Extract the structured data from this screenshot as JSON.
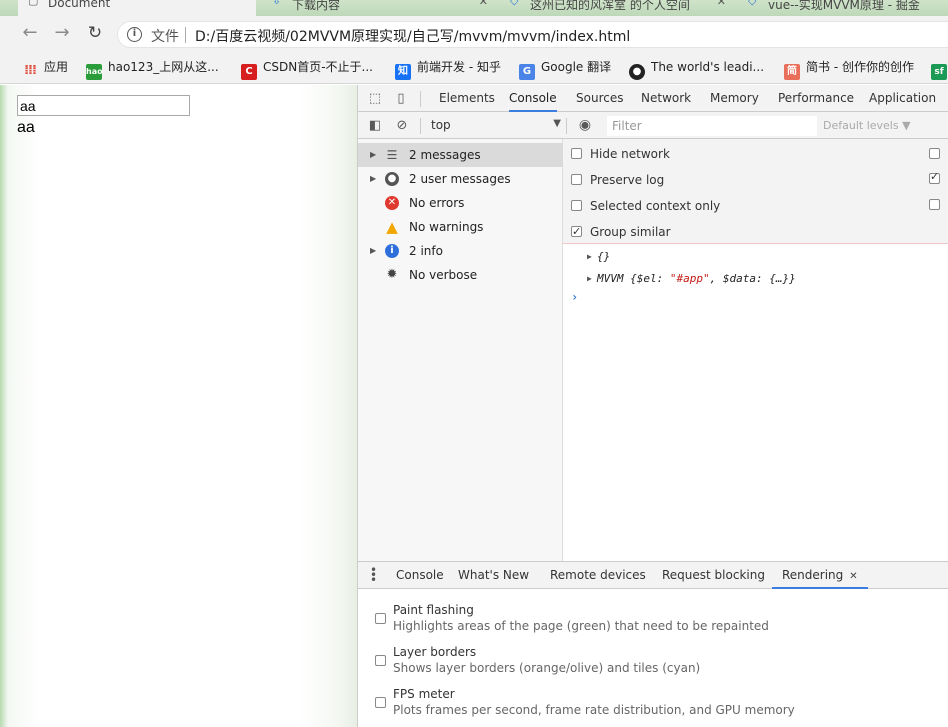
{
  "browser": {
    "tabs": [
      {
        "title": "Document",
        "active": true
      },
      {
        "title": "下载内容",
        "active": false
      },
      {
        "title": "这州已知的风浑室 的个人空间",
        "active": false
      },
      {
        "title": "vue--实现MVVM原理 - 掘金",
        "active": false
      }
    ],
    "address": {
      "label": "文件",
      "url": "D:/百度云视频/02MVVM原理实现/自己写/mvvm/mvvm/index.html"
    },
    "bookmarks": [
      {
        "label": "应用",
        "icon": "apps-grid-icon"
      },
      {
        "label": "hao123_上网从这...",
        "icon": "hao123-icon"
      },
      {
        "label": "CSDN首页-不止于...",
        "icon": "csdn-icon"
      },
      {
        "label": "前端开发 - 知乎",
        "icon": "zhihu-icon"
      },
      {
        "label": "Google 翻译",
        "icon": "google-translate-icon"
      },
      {
        "label": "The world's leadi...",
        "icon": "github-icon"
      },
      {
        "label": "简书 - 创作你的创作",
        "icon": "jianshu-icon"
      }
    ]
  },
  "page": {
    "input_value": "aa",
    "text": "aa"
  },
  "devtools": {
    "tabs": [
      "Elements",
      "Console",
      "Sources",
      "Network",
      "Memory",
      "Performance",
      "Application"
    ],
    "active_tab": "Console",
    "context": "top",
    "filter_placeholder": "Filter",
    "levels": "Default levels ▼",
    "sidebar": [
      {
        "label": "2 messages",
        "icon": "list-icon",
        "expandable": true,
        "selected": true
      },
      {
        "label": "2 user messages",
        "icon": "user-icon",
        "expandable": true
      },
      {
        "label": "No errors",
        "icon": "error-icon",
        "expandable": false
      },
      {
        "label": "No warnings",
        "icon": "warning-icon",
        "expandable": false
      },
      {
        "label": "2 info",
        "icon": "info-icon",
        "expandable": true
      },
      {
        "label": "No verbose",
        "icon": "verbose-icon",
        "expandable": false
      }
    ],
    "settings": [
      {
        "label": "Hide network",
        "checked": false
      },
      {
        "label": "Preserve log",
        "checked": false
      },
      {
        "label": "Selected context only",
        "checked": false
      },
      {
        "label": "Group similar",
        "checked": true
      }
    ],
    "console": {
      "line1": "{}",
      "line2_prefix": "MVVM {$el: ",
      "line2_str": "\"#app\"",
      "line2_suffix": ", $data: {…}}",
      "prompt": "›"
    },
    "drawer": {
      "tabs": [
        "Console",
        "What's New",
        "Remote devices",
        "Request blocking",
        "Rendering"
      ],
      "active_tab": "Rendering",
      "rendering": [
        {
          "title": "Paint flashing",
          "desc": "Highlights areas of the page (green) that need to be repainted"
        },
        {
          "title": "Layer borders",
          "desc": "Shows layer borders (orange/olive) and tiles (cyan)"
        },
        {
          "title": "FPS meter",
          "desc": "Plots frames per second, frame rate distribution, and GPU memory"
        }
      ]
    }
  },
  "colors": {
    "accent_blue": "#3b7de0",
    "error_red": "#e0392f",
    "warning_yellow": "#f2a600",
    "info_blue": "#2f6fdc",
    "string_red": "#c41a16"
  }
}
